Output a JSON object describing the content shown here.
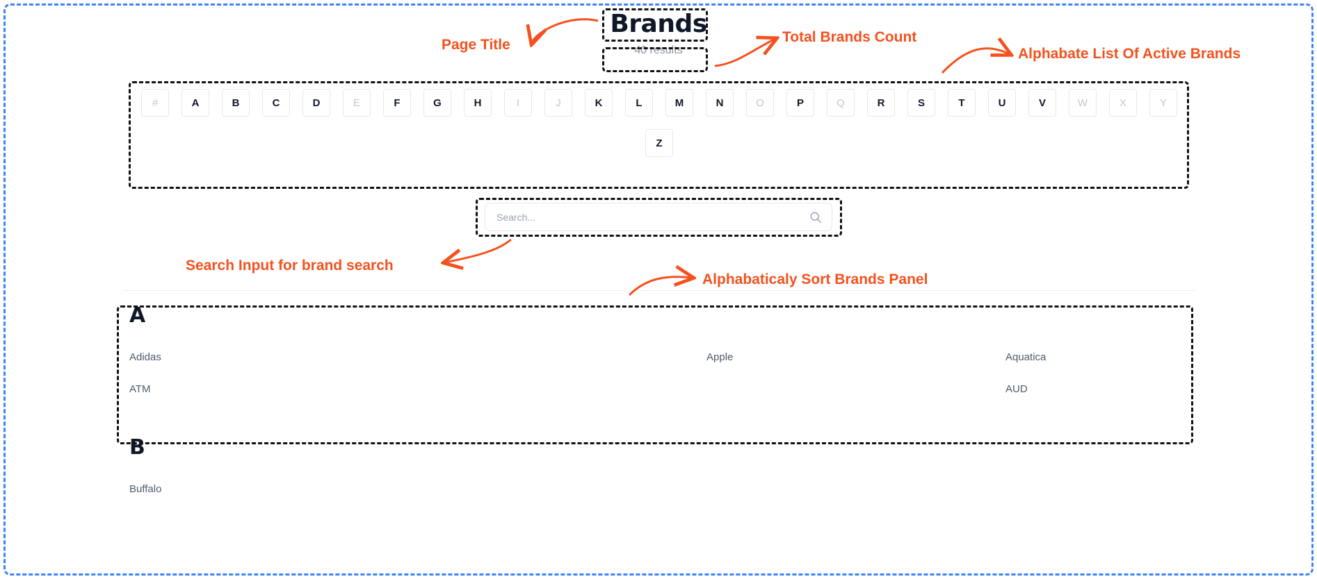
{
  "header": {
    "title": "Brands",
    "results_count": "40 results"
  },
  "alphabet": {
    "letters": [
      {
        "label": "#",
        "active": false
      },
      {
        "label": "A",
        "active": true
      },
      {
        "label": "B",
        "active": true
      },
      {
        "label": "C",
        "active": true
      },
      {
        "label": "D",
        "active": true
      },
      {
        "label": "E",
        "active": false
      },
      {
        "label": "F",
        "active": true
      },
      {
        "label": "G",
        "active": true
      },
      {
        "label": "H",
        "active": true
      },
      {
        "label": "I",
        "active": false
      },
      {
        "label": "J",
        "active": false
      },
      {
        "label": "K",
        "active": true
      },
      {
        "label": "L",
        "active": true
      },
      {
        "label": "M",
        "active": true
      },
      {
        "label": "N",
        "active": true
      },
      {
        "label": "O",
        "active": false
      },
      {
        "label": "P",
        "active": true
      },
      {
        "label": "Q",
        "active": false
      },
      {
        "label": "R",
        "active": true
      },
      {
        "label": "S",
        "active": true
      },
      {
        "label": "T",
        "active": true
      },
      {
        "label": "U",
        "active": true
      },
      {
        "label": "V",
        "active": true
      },
      {
        "label": "W",
        "active": false
      },
      {
        "label": "X",
        "active": false
      },
      {
        "label": "Y",
        "active": false
      },
      {
        "label": "Z",
        "active": true
      }
    ]
  },
  "search": {
    "placeholder": "Search...",
    "value": "",
    "icon": "search-icon"
  },
  "groups": [
    {
      "letter": "A",
      "brands": [
        "Adidas",
        "Apple",
        "Aquatica",
        "ATM",
        "",
        "AUD"
      ]
    },
    {
      "letter": "B",
      "brands": [
        "Buffalo",
        "",
        ""
      ]
    }
  ],
  "annotations": {
    "accent_color": "#f4511e",
    "box_color": "#111111",
    "frame_color": "#3b82f6",
    "labels": [
      {
        "id": "page-title",
        "text": "Page Title"
      },
      {
        "id": "total-brands-count",
        "text": "Total Brands Count"
      },
      {
        "id": "alphabet-list",
        "text": "Alphabate List Of Active Brands"
      },
      {
        "id": "search-input",
        "text": "Search Input for brand search"
      },
      {
        "id": "sort-panel",
        "text": "Alphabaticaly Sort Brands Panel"
      }
    ]
  }
}
